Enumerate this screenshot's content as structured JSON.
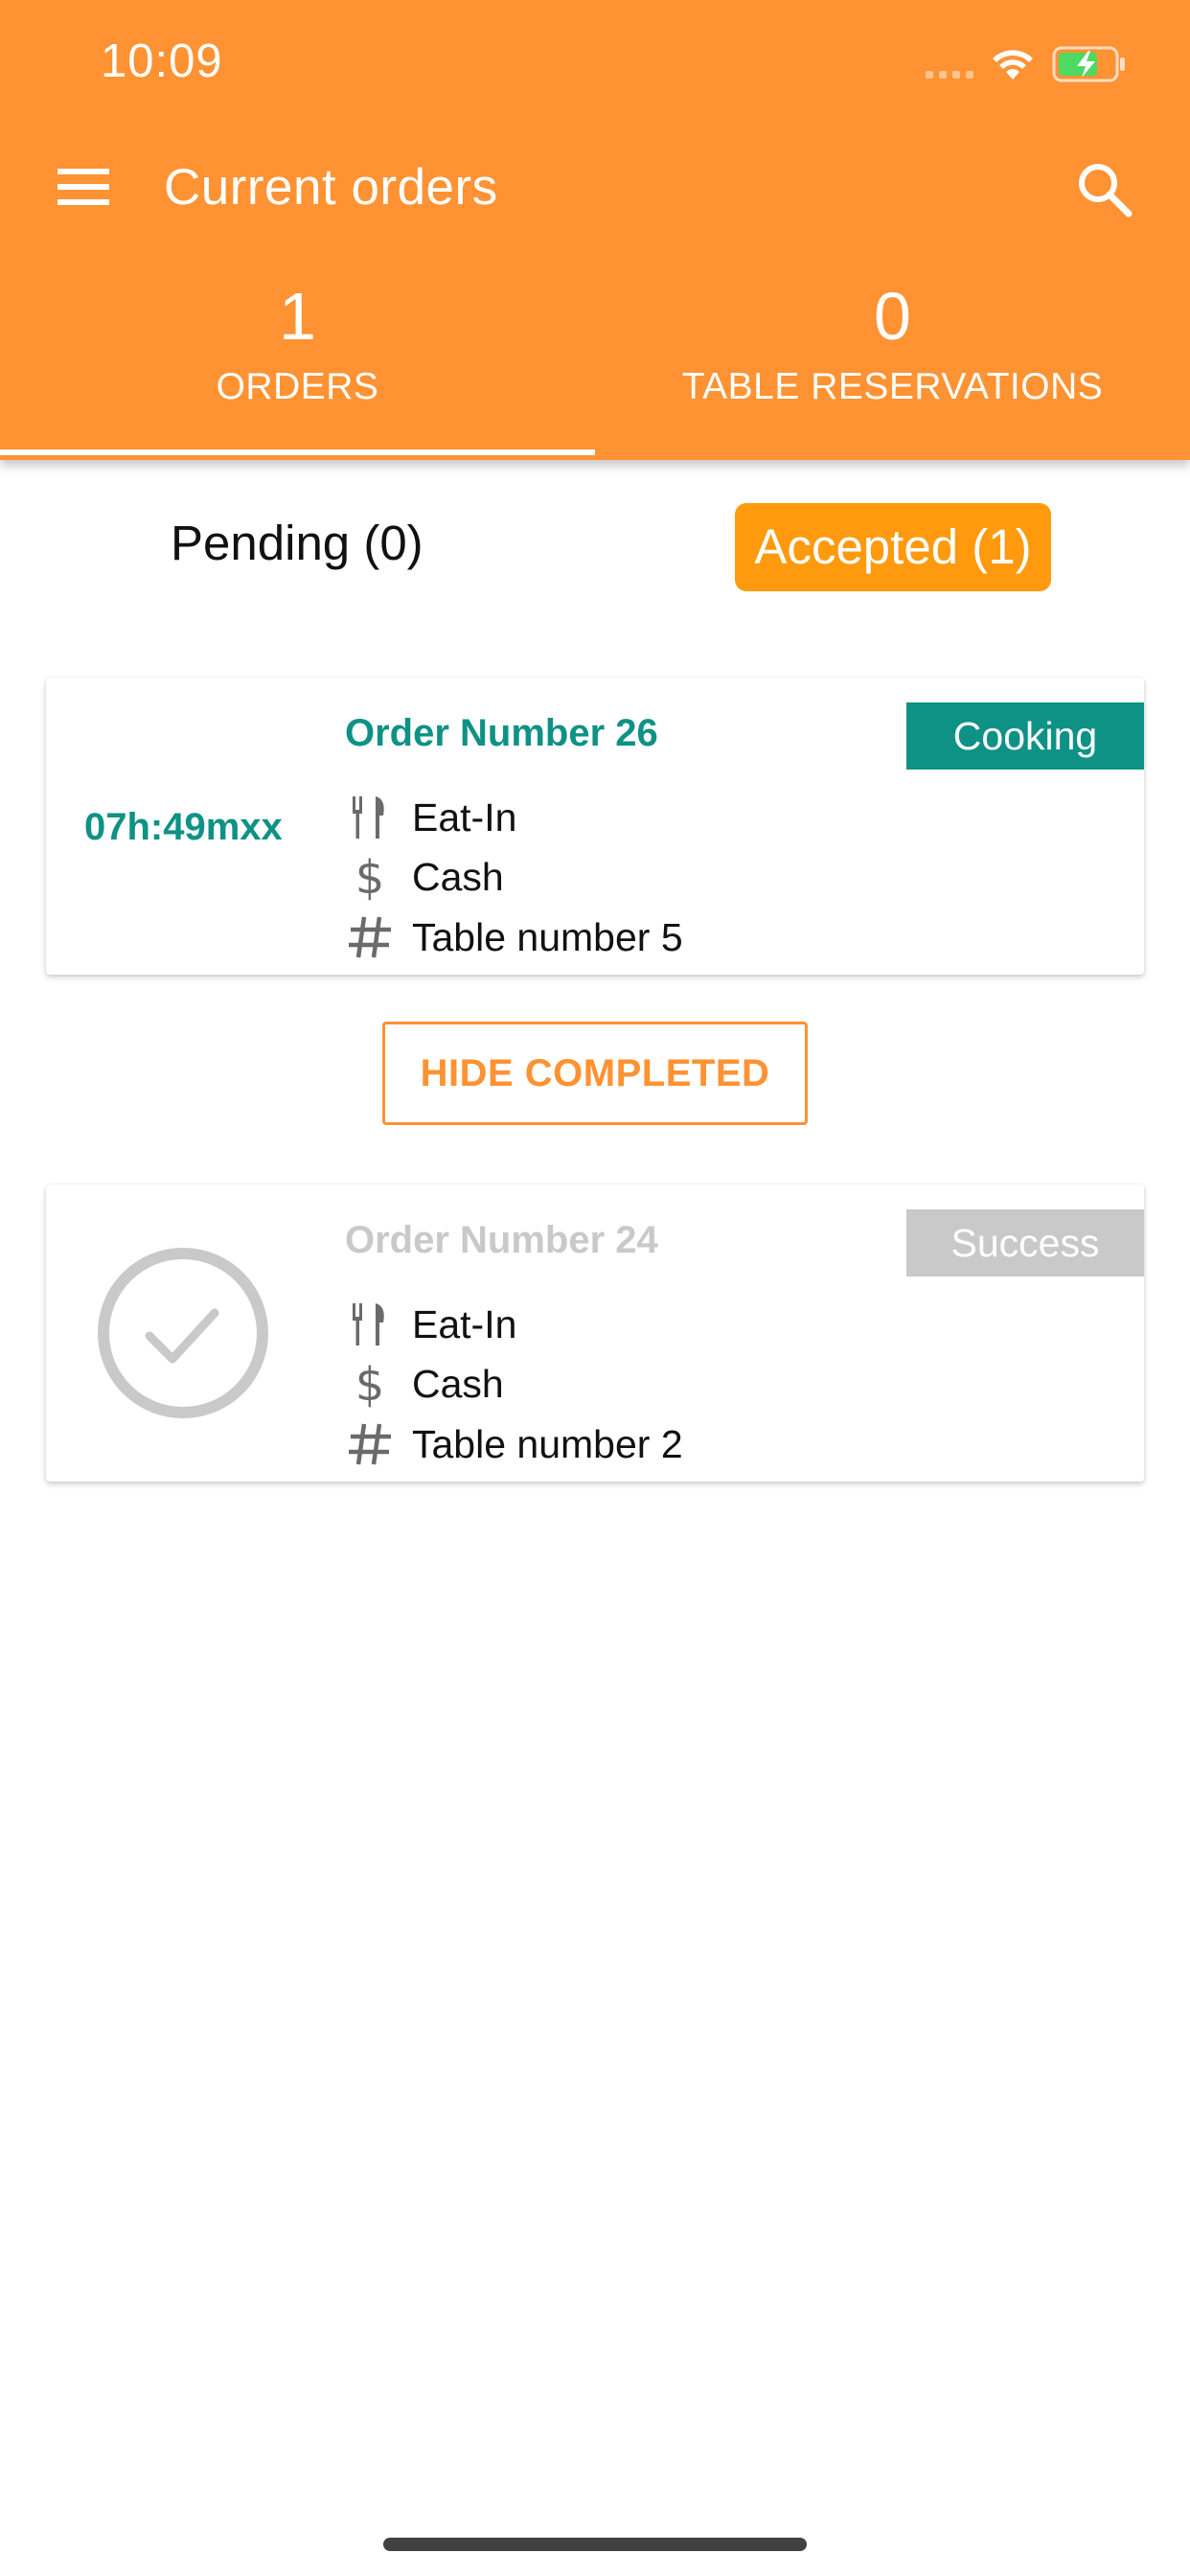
{
  "status_bar": {
    "time": "10:09"
  },
  "appbar": {
    "title": "Current orders",
    "icons": {
      "menu": "menu-icon",
      "search": "search-icon"
    }
  },
  "top_tabs": [
    {
      "count": "1",
      "label": "ORDERS",
      "active": true
    },
    {
      "count": "0",
      "label": "TABLE RESERVATIONS",
      "active": false
    }
  ],
  "filters": {
    "pending": "Pending (0)",
    "accepted": "Accepted (1)",
    "selected": "accepted"
  },
  "orders": [
    {
      "title": "Order Number 26",
      "timer": "07h:49mxx",
      "status": "Cooking",
      "service": "Eat-In",
      "payment": "Cash",
      "table": "Table number 5"
    },
    {
      "title": "Order Number 24",
      "status": "Success",
      "service": "Eat-In",
      "payment": "Cash",
      "table": "Table number 2"
    }
  ],
  "hide_completed_label": "HIDE COMPLETED",
  "colors": {
    "primary": "#FF9232",
    "accent": "#FF9A0E",
    "teal": "#0E9285",
    "muted": "#C9C9C9"
  }
}
